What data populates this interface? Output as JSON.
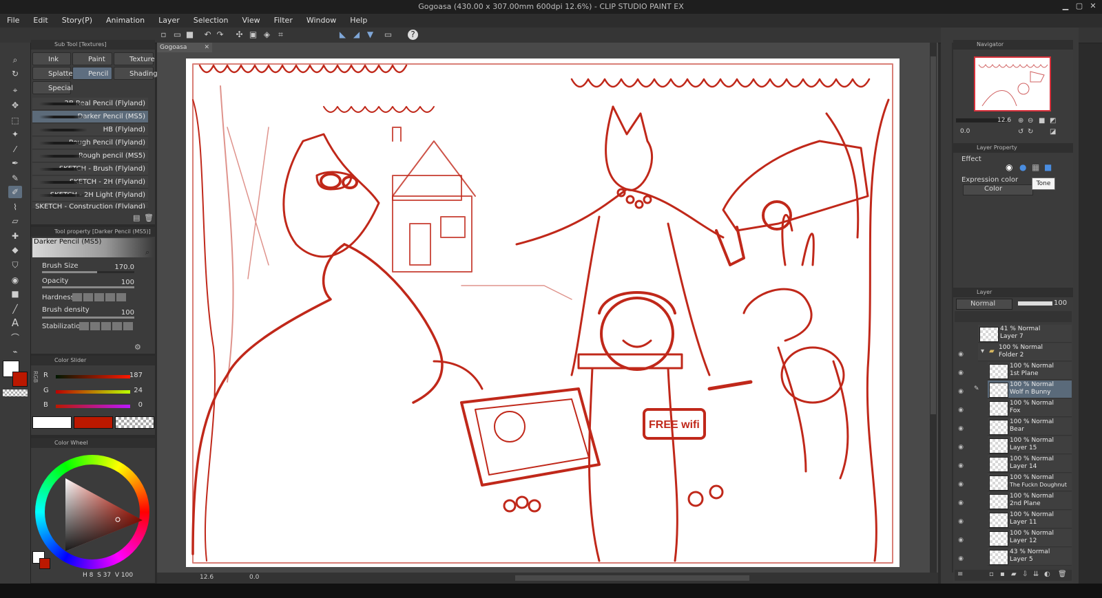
{
  "window": {
    "title": "Gogoasa (430.00 x 307.00mm 600dpi 12.6%)  - CLIP STUDIO PAINT EX"
  },
  "menu": [
    "File",
    "Edit",
    "Story(P)",
    "Animation",
    "Layer",
    "Selection",
    "View",
    "Filter",
    "Window",
    "Help"
  ],
  "subtool_panel": {
    "title": "Sub Tool [Textures]",
    "categories": [
      "Ink",
      "Paint",
      "Texture",
      "Splatter",
      "Pencil",
      "Shading",
      "Special"
    ],
    "selected_category": "Pencil",
    "brushes": [
      "2B Real Pencil (Flyland)",
      "Darker Pencil (MS5)",
      "HB (Flyland)",
      "Rough Pencil (Flyland)",
      "Rough pencil (MS5)",
      "SKETCH -  Brush (Flyland)",
      "SKETCH - 2H (Flyland)",
      "SKETCH - 2H Light (Flyland)",
      "SKETCH - Construction (Flyland)"
    ],
    "selected_brush": "Darker Pencil (MS5)"
  },
  "tool_property": {
    "title": "Tool property [Darker Pencil (MS5)]",
    "preview_name": "Darker Pencil (MS5)",
    "brush_size_label": "Brush Size",
    "brush_size": "170.0",
    "brush_size_level": 0.6,
    "opacity_label": "Opacity",
    "opacity": "100",
    "opacity_level": 1.0,
    "hardness_label": "Hardness",
    "brush_density_label": "Brush density",
    "brush_density": "100",
    "brush_density_level": 1.0,
    "stabilization_label": "Stabilization"
  },
  "color_slider": {
    "title": "Color Slider",
    "mode": "RGB",
    "r_label": "R",
    "r_value": "187",
    "g_label": "G",
    "g_value": "24",
    "b_label": "B",
    "b_value": "0",
    "main_color": "#bb1800"
  },
  "color_wheel": {
    "title": "Color Wheel",
    "readout_h": "8",
    "readout_s": "37",
    "readout_v": "100"
  },
  "document_tab": "Gogoasa",
  "canvas_status": {
    "zoom": "12.6",
    "rotation": "0.0"
  },
  "navigator": {
    "title": "Navigator",
    "zoom": "12.6",
    "rotation": "0.0"
  },
  "layer_property": {
    "title": "Layer Property",
    "effect_label": "Effect",
    "expression_color_label": "Expression color",
    "expression_color_value": "Color",
    "tooltip": "Tone"
  },
  "layer_panel": {
    "title": "Layer",
    "blend_mode": "Normal",
    "opacity": "100",
    "layers": [
      {
        "opacity": "41 %",
        "mode": "Normal",
        "name": "Layer 7"
      },
      {
        "opacity": "100 %",
        "mode": "Normal",
        "name": "Folder 2"
      },
      {
        "opacity": "100 %",
        "mode": "Normal",
        "name": "1st Plane"
      },
      {
        "opacity": "100 %",
        "mode": "Normal",
        "name": "Wolf n Bunny"
      },
      {
        "opacity": "100 %",
        "mode": "Normal",
        "name": "Fox"
      },
      {
        "opacity": "100 %",
        "mode": "Normal",
        "name": "Bear"
      },
      {
        "opacity": "100 %",
        "mode": "Normal",
        "name": "Layer 15"
      },
      {
        "opacity": "100 %",
        "mode": "Normal",
        "name": "Layer 14"
      },
      {
        "opacity": "100 %",
        "mode": "Normal",
        "name": "The Fuckn Doughnut"
      },
      {
        "opacity": "100 %",
        "mode": "Normal",
        "name": "2nd Plane"
      },
      {
        "opacity": "100 %",
        "mode": "Normal",
        "name": "Layer 11"
      },
      {
        "opacity": "100 %",
        "mode": "Normal",
        "name": "Layer 12"
      },
      {
        "opacity": "43 %",
        "mode": "Normal",
        "name": "Layer 5"
      }
    ],
    "selected_layer": "Wolf n Bunny"
  },
  "artwork": {
    "sign_text": "FREE wifi",
    "line_color": "#c0281a"
  }
}
